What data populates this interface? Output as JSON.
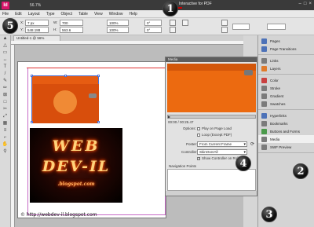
{
  "app": {
    "logo": "Id",
    "zoom": "56.7%",
    "workspace": "Interactive for PDF"
  },
  "menu": [
    "File",
    "Edit",
    "Layout",
    "Type",
    "Object",
    "Table",
    "View",
    "Window",
    "Help"
  ],
  "control": {
    "x": "7 px",
    "y": "548.188",
    "w": "100%",
    "h": "100%",
    "w2": "700",
    "h2": "563.6",
    "angle": "0°",
    "shear": "0°"
  },
  "document": {
    "tab": "Untitled-1 @ 56%"
  },
  "image": {
    "line1": "WEB",
    "line2": "DEV-IL",
    "line3": ".blogspot.com"
  },
  "footer": "© http://webdev-il.blogspot.com",
  "media": {
    "title": "Media",
    "time": "00:00 / 00:25.47",
    "options_label": "Options:",
    "opt1": "Play on Page Load",
    "opt1_checked": false,
    "opt2": "Loop (Except PDF)",
    "opt2_checked": false,
    "poster_label": "Poster:",
    "poster_value": "From Current Frame",
    "controller_label": "Controller:",
    "controller_value": "SkinOverAll",
    "show_ctrl": "Show Controller on Rollover",
    "show_ctrl_checked": true,
    "nav_label": "Navigation Points"
  },
  "dock": {
    "groups": [
      [
        {
          "label": "Pages",
          "icon": "pages-icon",
          "color": "blue"
        },
        {
          "label": "Page Transitions",
          "icon": "page-transitions-icon",
          "color": "blue"
        }
      ],
      [
        {
          "label": "Links",
          "icon": "links-icon",
          "color": ""
        },
        {
          "label": "Layers",
          "icon": "layers-icon",
          "color": "orange"
        }
      ],
      [
        {
          "label": "Color",
          "icon": "color-icon",
          "color": "red"
        },
        {
          "label": "Stroke",
          "icon": "stroke-icon",
          "color": ""
        },
        {
          "label": "Gradient",
          "icon": "gradient-icon",
          "color": ""
        },
        {
          "label": "Swatches",
          "icon": "swatches-icon",
          "color": ""
        }
      ],
      [
        {
          "label": "Hyperlinks",
          "icon": "hyperlinks-icon",
          "color": "blue"
        },
        {
          "label": "Bookmarks",
          "icon": "bookmarks-icon",
          "color": ""
        },
        {
          "label": "Buttons and Forms",
          "icon": "buttons-forms-icon",
          "color": "green"
        },
        {
          "label": "Media",
          "icon": "media-icon",
          "color": "",
          "active": true
        },
        {
          "label": "SWF Preview",
          "icon": "swf-preview-icon",
          "color": ""
        }
      ]
    ]
  },
  "badges": [
    "1",
    "2",
    "3",
    "4",
    "5"
  ]
}
